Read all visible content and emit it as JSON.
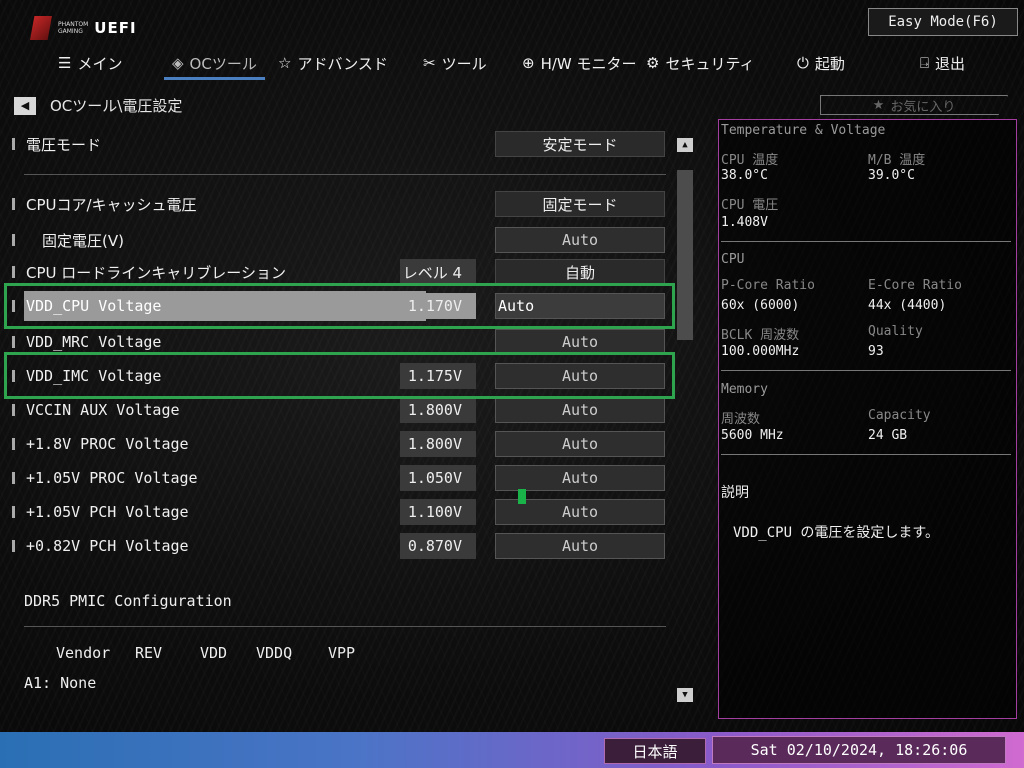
{
  "logo": {
    "small_line1": "PHANTOM",
    "small_line2": "GAMING",
    "uefi": "UEFI"
  },
  "easy_mode": "Easy Mode(F6)",
  "tabs": [
    {
      "icon": "☰",
      "label": "メイン"
    },
    {
      "icon": "◈",
      "label": "OCツール"
    },
    {
      "icon": "☆",
      "label": "アドバンスド"
    },
    {
      "icon": "✂",
      "label": "ツール"
    },
    {
      "icon": "⊕",
      "label": "H/W モニター"
    },
    {
      "icon": "⚙",
      "label": "セキュリティ"
    },
    {
      "icon": "⏻",
      "label": "起動"
    },
    {
      "icon": "⍈",
      "label": "退出"
    }
  ],
  "breadcrumb": "OCツール\\電圧設定",
  "favorite": "お気に入り",
  "settings": {
    "voltage_mode": {
      "label": "電圧モード",
      "option": "安定モード"
    },
    "cpu_core_cache": {
      "label": "CPUコア/キャッシュ電圧",
      "option": "固定モード"
    },
    "fixed_voltage": {
      "label": "固定電圧(V)",
      "option": "Auto"
    },
    "cpu_llc": {
      "label": "CPU ロードラインキャリブレーション",
      "value": "レベル 4",
      "option": "自動"
    },
    "vdd_cpu": {
      "label": "VDD_CPU Voltage",
      "value": "1.170V",
      "option": "Auto"
    },
    "vdd_mrc": {
      "label": "VDD_MRC Voltage",
      "option": "Auto"
    },
    "vdd_imc": {
      "label": "VDD_IMC Voltage",
      "value": "1.175V",
      "option": "Auto"
    },
    "vccin_aux": {
      "label": "VCCIN AUX Voltage",
      "value": "1.800V",
      "option": "Auto"
    },
    "proc_18": {
      "label": "+1.8V PROC Voltage",
      "value": "1.800V",
      "option": "Auto"
    },
    "proc_105": {
      "label": "+1.05V PROC Voltage",
      "value": "1.050V",
      "option": "Auto"
    },
    "pch_105": {
      "label": "+1.05V PCH Voltage",
      "value": "1.100V",
      "option": "Auto"
    },
    "pch_082": {
      "label": "+0.82V PCH Voltage",
      "value": "0.870V",
      "option": "Auto"
    }
  },
  "pmic": {
    "title": "DDR5 PMIC Configuration",
    "columns": [
      "Vendor",
      "REV",
      "VDD",
      "VDDQ",
      "VPP"
    ],
    "a1": "A1: None"
  },
  "panel": {
    "temp_title": "Temperature & Voltage",
    "cpu_temp_label": "CPU 温度",
    "cpu_temp": "38.0°C",
    "mb_temp_label": "M/B 温度",
    "mb_temp": "39.0°C",
    "cpu_volt_label": "CPU 電圧",
    "cpu_volt": "1.408V",
    "cpu_title": "CPU",
    "pcore_label": "P-Core Ratio",
    "pcore": "60x (6000)",
    "ecore_label": "E-Core Ratio",
    "ecore": "44x (4400)",
    "bclk_label": "BCLK 周波数",
    "bclk": "100.000MHz",
    "quality_label": "Quality",
    "quality": "93",
    "mem_title": "Memory",
    "freq_label": "周波数",
    "freq": "5600 MHz",
    "cap_label": "Capacity",
    "cap": "24 GB",
    "desc_title": "説明",
    "desc": "VDD_CPU の電圧を設定します。"
  },
  "footer": {
    "language": "日本語",
    "datetime": "Sat 02/10/2024, 18:26:06"
  },
  "colors": {
    "highlight_box": "#2ea44f",
    "active_tab_underline": "#4a7fc1",
    "panel_border": "#a33da0"
  }
}
